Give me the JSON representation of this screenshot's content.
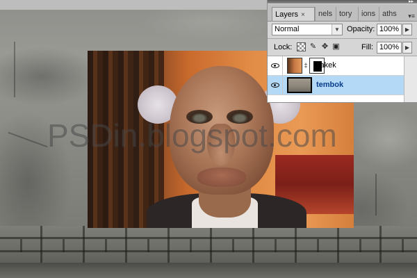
{
  "watermark": {
    "text": "PSDin.blogspot.com"
  },
  "layers_panel": {
    "tabs": [
      {
        "label": "Layers",
        "active": true
      },
      {
        "label": "nels"
      },
      {
        "label": "tory"
      },
      {
        "label": "ions"
      },
      {
        "label": "aths"
      }
    ],
    "tab_close_glyph": "×",
    "panel_menu_icon": "panel-menu-icon",
    "blend_mode": "Normal",
    "opacity_label": "Opacity:",
    "opacity_value": "100%",
    "lock_label": "Lock:",
    "fill_label": "Fill:",
    "fill_value": "100%",
    "layers": [
      {
        "name": "kakek",
        "visible": true,
        "selected": false,
        "has_mask": true
      },
      {
        "name": "tembok",
        "visible": true,
        "selected": true,
        "has_mask": false
      }
    ],
    "colors": {
      "selection": "#b3d9f7",
      "selected_text": "#0a3d8a"
    }
  }
}
